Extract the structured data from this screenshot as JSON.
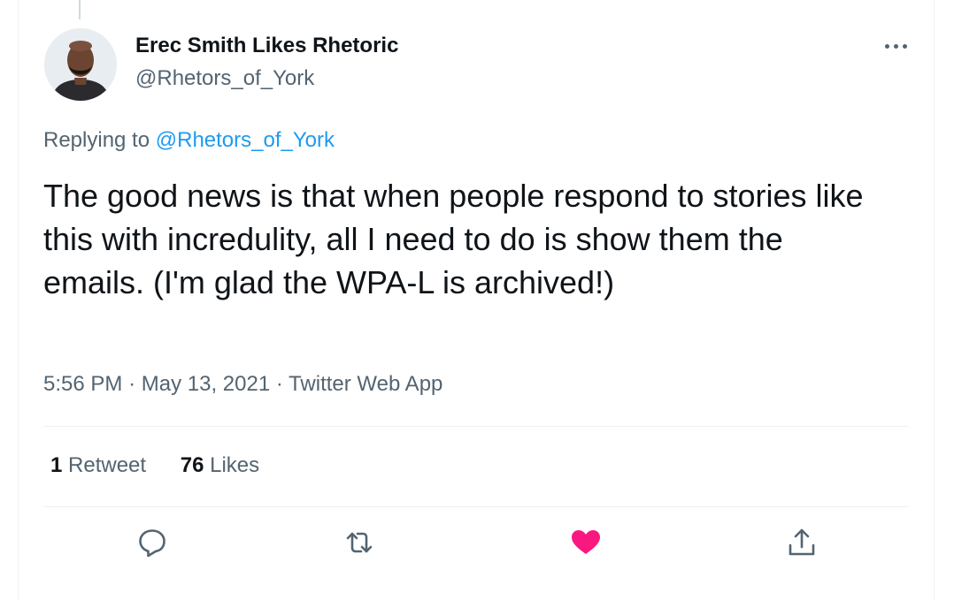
{
  "author": {
    "display_name": "Erec Smith Likes Rhetoric",
    "handle": "@Rhetors_of_York"
  },
  "reply": {
    "prefix": "Replying to",
    "to_handle": "@Rhetors_of_York"
  },
  "tweet": {
    "text": "The good news is that when people respond to stories like this with incredulity, all I need to do is show them the emails. (I'm glad the WPA-L is archived!)"
  },
  "meta": {
    "time": "5:56 PM",
    "separator": "·",
    "date": "May 13, 2021",
    "source": "Twitter Web App"
  },
  "stats": {
    "retweets_count": "1",
    "retweets_label": "Retweet",
    "likes_count": "76",
    "likes_label": "Likes"
  },
  "actions": {
    "reply_icon": "reply-icon",
    "retweet_icon": "retweet-icon",
    "like_icon": "heart-icon",
    "share_icon": "share-icon"
  },
  "colors": {
    "accent_blue": "#1d9bf0",
    "like_red": "#f91880",
    "secondary_text": "#536471",
    "primary_text": "#0f1419"
  }
}
